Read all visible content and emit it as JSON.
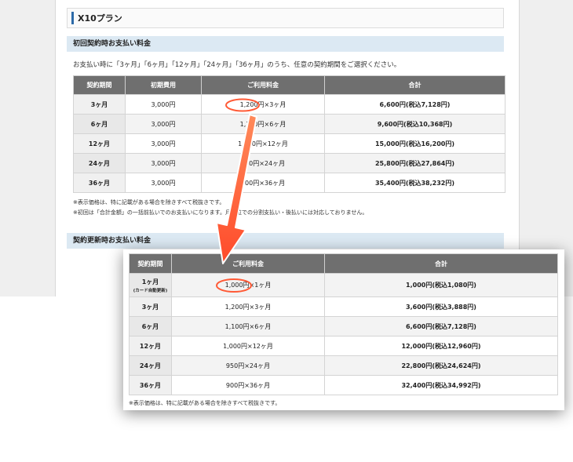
{
  "plan_title": "X10プラン",
  "initial_section": {
    "heading": "初回契約時お支払い料金",
    "intro": "お支払い時に「3ヶ月」「6ヶ月」「12ヶ月」「24ヶ月」「36ヶ月」のうち、任意の契約期間をご選択ください。",
    "columns": [
      "契約期間",
      "初期費用",
      "ご利用料金",
      "合計"
    ],
    "rows": [
      {
        "period": "3ヶ月",
        "initial": "3,000円",
        "usage": "1,200円×3ヶ月",
        "total": "6,600円(税込7,128円)"
      },
      {
        "period": "6ヶ月",
        "initial": "3,000円",
        "usage": "1,100円×6ヶ月",
        "total": "9,600円(税込10,368円)"
      },
      {
        "period": "12ヶ月",
        "initial": "3,000円",
        "usage": "1,000円×12ヶ月",
        "total": "15,000円(税込16,200円)"
      },
      {
        "period": "24ヶ月",
        "initial": "3,000円",
        "usage": "950円×24ヶ月",
        "total": "25,800円(税込27,864円)"
      },
      {
        "period": "36ヶ月",
        "initial": "3,000円",
        "usage": "900円×36ヶ月",
        "total": "35,400円(税込38,232円)"
      }
    ],
    "notes": [
      "※表示価格は、特に記載がある場合を除きすべて税抜きです。",
      "※初回は「合計金額」の一括前払いでのお支払いになります。月単位での分割支払い・後払いには対応しておりません。"
    ]
  },
  "renewal_section": {
    "heading": "契約更新時お支払い料金"
  },
  "renewal_panel": {
    "columns": [
      "契約期間",
      "ご利用料金",
      "合計"
    ],
    "rows": [
      {
        "period": "1ヶ月",
        "sub": "(カード自動更新)",
        "usage": "1,000円×1ヶ月",
        "total": "1,000円(税込1,080円)"
      },
      {
        "period": "3ヶ月",
        "sub": "",
        "usage": "1,200円×3ヶ月",
        "total": "3,600円(税込3,888円)"
      },
      {
        "period": "6ヶ月",
        "sub": "",
        "usage": "1,100円×6ヶ月",
        "total": "6,600円(税込7,128円)"
      },
      {
        "period": "12ヶ月",
        "sub": "",
        "usage": "1,000円×12ヶ月",
        "total": "12,000円(税込12,960円)"
      },
      {
        "period": "24ヶ月",
        "sub": "",
        "usage": "950円×24ヶ月",
        "total": "22,800円(税込24,624円)"
      },
      {
        "period": "36ヶ月",
        "sub": "",
        "usage": "900円×36ヶ月",
        "total": "32,400円(税込34,992円)"
      }
    ],
    "note": "※表示価格は、特に記載がある場合を除きすべて税抜きです。"
  },
  "colors": {
    "header_bg": "#6f6f6f",
    "section_bg": "#dce9f3",
    "accent_bar": "#2d6aa8",
    "annotation": "#ff5a36"
  }
}
